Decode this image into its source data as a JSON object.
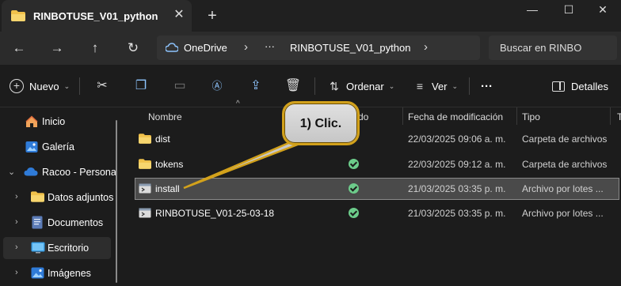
{
  "tab": {
    "title": "RINBOTUSE_V01_python",
    "close_icon": "close-icon",
    "new_tab_icon": "plus-icon"
  },
  "window": {
    "minimize": "minimize-icon",
    "maximize": "maximize-icon",
    "close": "close-icon"
  },
  "address": {
    "segments": [
      "OneDrive",
      "RINBOTUSE_V01_python"
    ],
    "overflow": "···",
    "search_placeholder": "Buscar en RINBO"
  },
  "commands": {
    "new_label": "Nuevo",
    "sort_label": "Ordenar",
    "view_label": "Ver",
    "more_label": "···",
    "details_label": "Detalles"
  },
  "sidebar": {
    "items": [
      {
        "label": "Inicio",
        "icon": "home-icon"
      },
      {
        "label": "Galería",
        "icon": "gallery-icon"
      },
      {
        "label": "Racoo - Persona",
        "icon": "cloud-icon"
      },
      {
        "label": "Datos adjuntos",
        "icon": "folder-icon"
      },
      {
        "label": "Documentos",
        "icon": "documents-icon"
      },
      {
        "label": "Escritorio",
        "icon": "desktop-icon"
      },
      {
        "label": "Imágenes",
        "icon": "pictures-icon"
      }
    ]
  },
  "columns": {
    "name": "Nombre",
    "status": "do",
    "modified": "Fecha de modificación",
    "type": "Tipo",
    "extra": "T"
  },
  "files": [
    {
      "name": "dist",
      "modified": "22/03/2025 09:06 a. m.",
      "type": "Carpeta de archivos",
      "status": ""
    },
    {
      "name": "tokens",
      "modified": "22/03/2025 09:12 a. m.",
      "type": "Carpeta de archivos",
      "status": "synced"
    },
    {
      "name": "install",
      "modified": "21/03/2025 03:35 p. m.",
      "type": "Archivo por lotes ...",
      "status": "synced"
    },
    {
      "name": "RINBOTUSE_V01-25-03-18",
      "modified": "21/03/2025 03:35 p. m.",
      "type": "Archivo por lotes ...",
      "status": "synced"
    }
  ],
  "callout": {
    "text": "1) Clic."
  },
  "colors": {
    "accent_folder": "#f0c14b",
    "callout_border": "#d2a11b",
    "sync_green": "#6ccb8a"
  }
}
